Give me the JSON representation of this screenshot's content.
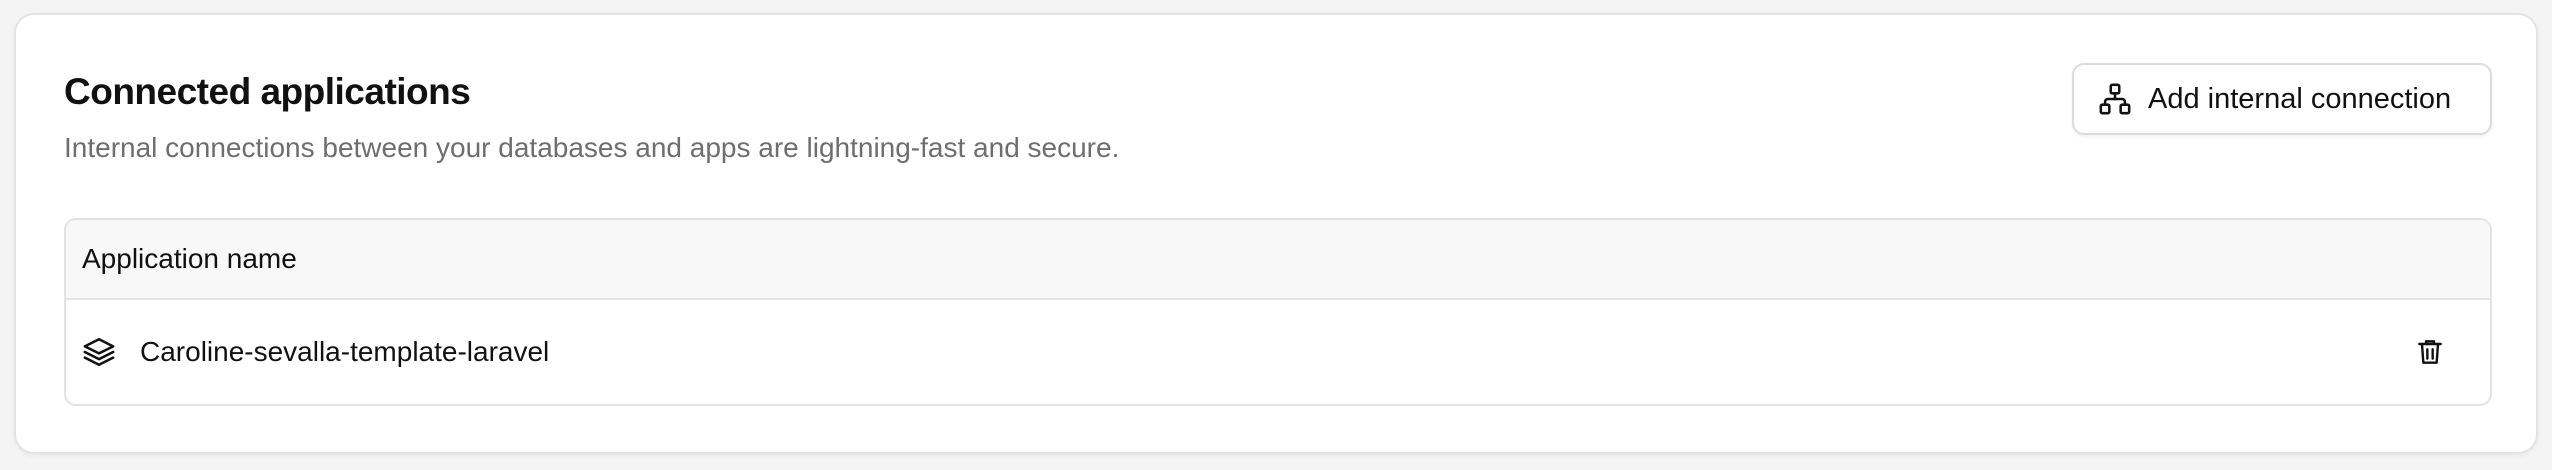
{
  "section": {
    "title": "Connected applications",
    "subtitle": "Internal connections between your databases and apps are lightning-fast and secure."
  },
  "actions": {
    "add_connection_label": "Add internal connection",
    "add_connection_icon": "network-icon"
  },
  "table": {
    "columns": [
      "Application name"
    ],
    "rows": [
      {
        "name": "Caroline-sevalla-template-laravel",
        "icon": "layers-icon",
        "action_icon": "trash-icon"
      }
    ]
  },
  "colors": {
    "text_primary": "#111111",
    "text_secondary": "#6e6e6e",
    "border": "#e3e3e3",
    "header_bg": "#f8f8f8",
    "page_bg": "#f4f4f4"
  }
}
